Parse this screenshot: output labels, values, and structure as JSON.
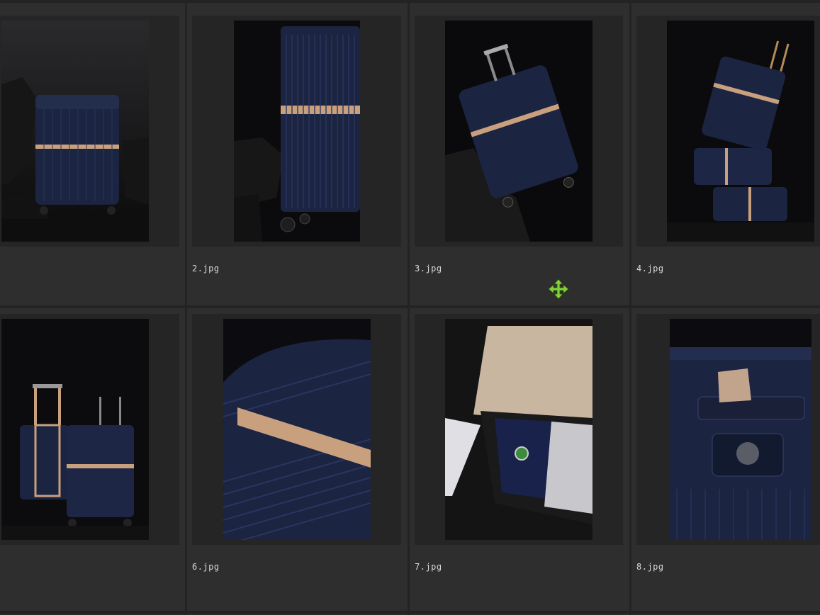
{
  "files": [
    {
      "name": "",
      "icon": "luggage-photo"
    },
    {
      "name": "2.jpg",
      "icon": "luggage-photo"
    },
    {
      "name": "3.jpg",
      "icon": "luggage-photo"
    },
    {
      "name": "4.jpg",
      "icon": "luggage-photo"
    },
    {
      "name": "",
      "icon": "luggage-photo"
    },
    {
      "name": "6.jpg",
      "icon": "luggage-photo"
    },
    {
      "name": "7.jpg",
      "icon": "luggage-photo"
    },
    {
      "name": "8.jpg",
      "icon": "luggage-photo"
    }
  ],
  "cursor": {
    "icon": "move-cursor-icon",
    "color": "#7fd23a"
  },
  "colors": {
    "background": "#2b2b2b",
    "label": "#d8d8d8",
    "accent_strap": "#c9a07e",
    "luggage_navy": "#1b2440"
  }
}
